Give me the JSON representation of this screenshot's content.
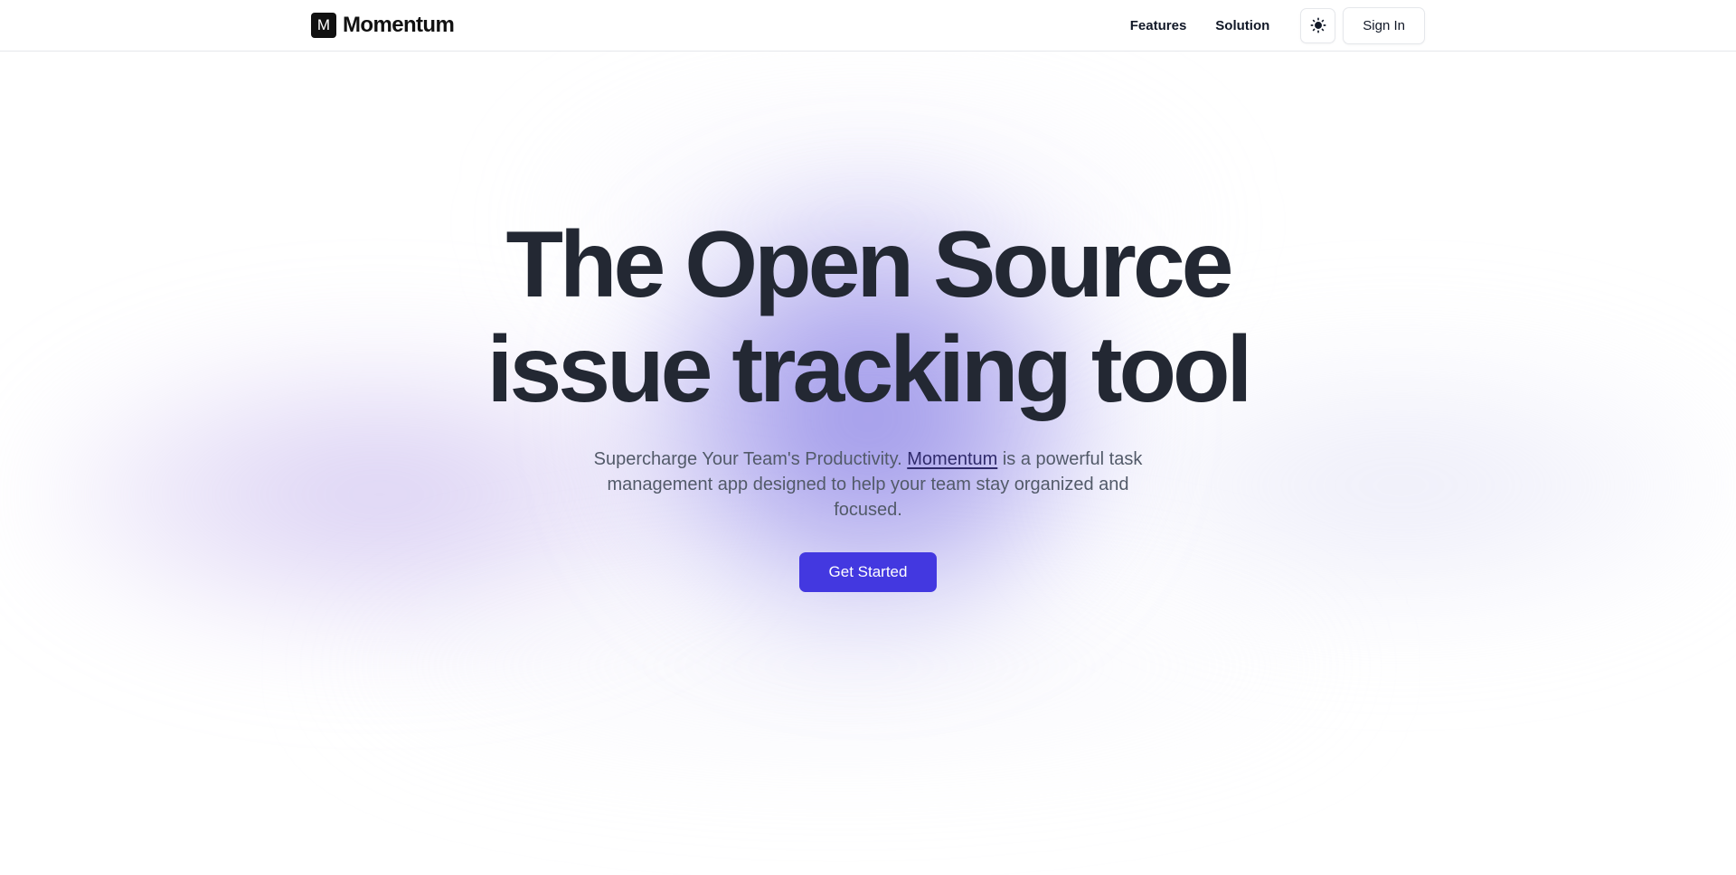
{
  "header": {
    "brand": {
      "logo_letter": "M",
      "name": "Momentum"
    },
    "nav": {
      "features": "Features",
      "solution": "Solution"
    },
    "theme_toggle_icon": "sun-icon",
    "sign_in": "Sign In"
  },
  "hero": {
    "title_line1": "The Open Source",
    "title_line2": "issue tracking tool",
    "subtitle_before": "Supercharge Your Team's Productivity. ",
    "subtitle_link": "Momentum",
    "subtitle_after": " is a powerful task management app designed to help your team stay organized and focused.",
    "cta": "Get Started"
  },
  "colors": {
    "primary": "#4338e0",
    "text_dark": "#232833",
    "text_muted": "#525a69",
    "border": "#e5e7eb",
    "glow": "#7e76e2"
  }
}
